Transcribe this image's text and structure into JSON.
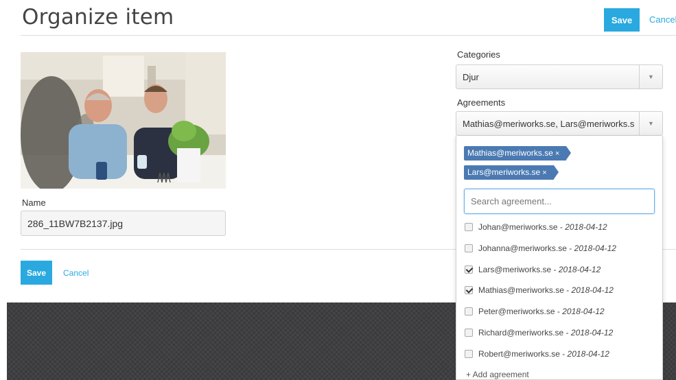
{
  "header": {
    "title": "Organize item",
    "save_label": "Save",
    "cancel_label": "Cancel"
  },
  "item": {
    "name_label": "Name",
    "name_value": "286_11BW7B2137.jpg"
  },
  "categories": {
    "label": "Categories",
    "selected": "Djur"
  },
  "agreements": {
    "label": "Agreements",
    "selected_summary": "Mathias@meriworks.se, Lars@meriworks.se",
    "tags": [
      {
        "label": "Mathias@meriworks.se",
        "remove": "×"
      },
      {
        "label": "Lars@meriworks.se",
        "remove": "×"
      }
    ],
    "search_placeholder": "Search agreement...",
    "options": [
      {
        "email": "Johan@meriworks.se",
        "sep": " - ",
        "date": "2018-04-12",
        "checked": false
      },
      {
        "email": "Johanna@meriworks.se",
        "sep": " - ",
        "date": "2018-04-12",
        "checked": false
      },
      {
        "email": "Lars@meriworks.se",
        "sep": " - ",
        "date": "2018-04-12",
        "checked": true
      },
      {
        "email": "Mathias@meriworks.se",
        "sep": " - ",
        "date": "2018-04-12",
        "checked": true
      },
      {
        "email": "Peter@meriworks.se",
        "sep": " - ",
        "date": "2018-04-12",
        "checked": false
      },
      {
        "email": "Richard@meriworks.se",
        "sep": " - ",
        "date": "2018-04-12",
        "checked": false
      },
      {
        "email": "Robert@meriworks.se",
        "sep": " - ",
        "date": "2018-04-12",
        "checked": false
      }
    ],
    "add_label": "+ Add agreement"
  },
  "footer": {
    "save_label": "Save",
    "cancel_label": "Cancel"
  },
  "colors": {
    "accent": "#29a9e0",
    "tag": "#4b7ab2",
    "footer_dark": "#3a3a3c"
  }
}
